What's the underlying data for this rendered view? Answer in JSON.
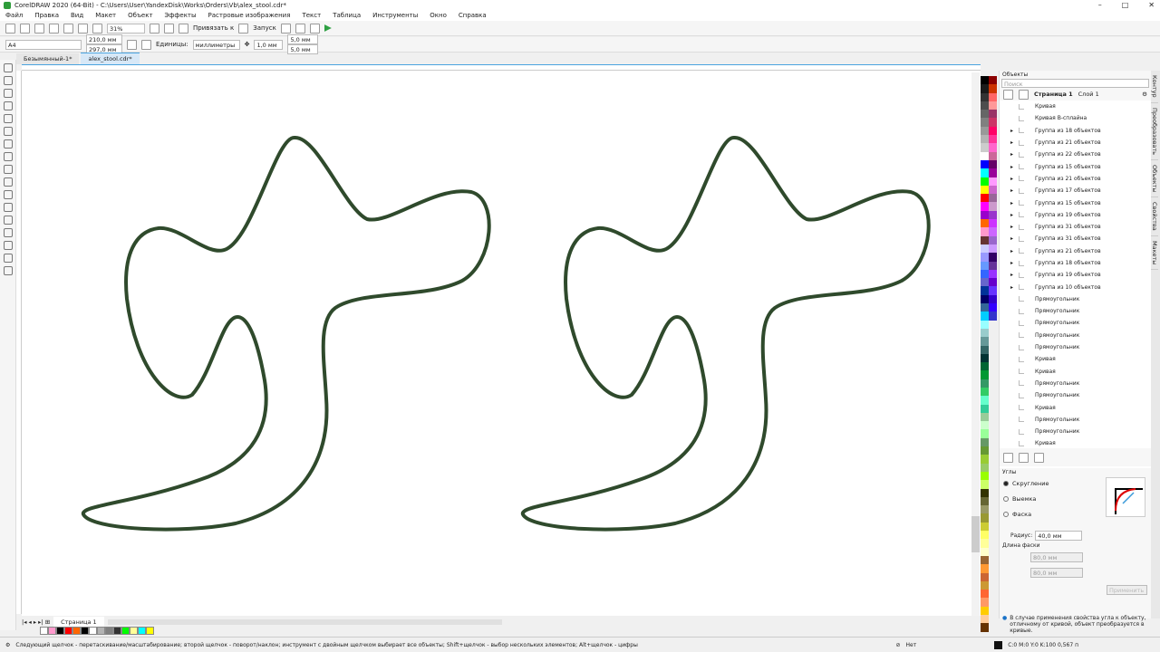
{
  "title": "CorelDRAW 2020 (64-Bit) - C:\\Users\\User\\YandexDisk\\Works\\Orders\\Vb\\alex_stool.cdr*",
  "menu": [
    "Файл",
    "Правка",
    "Вид",
    "Макет",
    "Объект",
    "Эффекты",
    "Растровые изображения",
    "Текст",
    "Таблица",
    "Инструменты",
    "Окно",
    "Справка"
  ],
  "toolbar": {
    "zoom": "31%",
    "snap": "Привязать к",
    "launch": "Запуск"
  },
  "props": {
    "page_size": "A4",
    "width": "210,0 мм",
    "height": "297,0 мм",
    "units_label": "Единицы:",
    "units": "миллиметры",
    "nudge": "1,0 мм",
    "dup_x": "5,0 мм",
    "dup_y": "5,0 мм"
  },
  "tabs": [
    "Безымянный-1*",
    "alex_stool.cdr*"
  ],
  "objects": {
    "search_placeholder": "Поиск",
    "page": "Страница 1",
    "layer": "Слой 1",
    "items": [
      "Кривая",
      "Кривая B-сплайна",
      "Группа из 18 объектов",
      "Группа из 21 объектов",
      "Группа из 22 объектов",
      "Группа из 15 объектов",
      "Группа из 21 объектов",
      "Группа из 17 объектов",
      "Группа из 15 объектов",
      "Группа из 19 объектов",
      "Группа из 31 объектов",
      "Группа из 31 объектов",
      "Группа из 21 объектов",
      "Группа из 18 объектов",
      "Группа из 19 объектов",
      "Группа из 10 объектов",
      "Прямоугольник",
      "Прямоугольник",
      "Прямоугольник",
      "Прямоугольник",
      "Прямоугольник",
      "Кривая",
      "Кривая",
      "Прямоугольник",
      "Прямоугольник",
      "Кривая",
      "Прямоугольник",
      "Прямоугольник",
      "Кривая"
    ],
    "panel_title": "Объекты"
  },
  "corners": {
    "title": "Углы",
    "options": [
      "Скругление",
      "Выемка",
      "Фаска"
    ],
    "radius_label": "Радиус:",
    "radius": "40,0 мм",
    "chamfer_label": "Длина фаски",
    "a": "80,0 мм",
    "b": "80,0 мм",
    "apply": "Применить",
    "info": "В случае применения свойства угла к объекту, отличному от кривой, объект преобразуется в кривые."
  },
  "sidetabs": [
    "Контур",
    "Преобразовать",
    "Объекты",
    "Свойства",
    "Макеты"
  ],
  "page_tab": "Страница 1",
  "status": {
    "hint": "Следующий щелчок - перетаскивание/масштабирование; второй щелчок - поворот/наклон; инструмент с двойным щелчком выбирает все объекты; Shift+щелчок - выбор нескольких элементов; Alt+щелчок - цифры",
    "fill": "Нет",
    "outline": "C:0 M:0 Y:0 K:100  0,567 п"
  },
  "colors": {
    "shape_stroke": "#2f4a2c",
    "accent": "#4aa3df"
  },
  "palette": [
    "#000",
    "#8b0000",
    "#1a1a1a",
    "#cc3300",
    "#333",
    "#ff6666",
    "#4d4d4d",
    "#ff9999",
    "#666",
    "#993366",
    "#808080",
    "#cc3366",
    "#999",
    "#ff0066",
    "#b3b3b3",
    "#ff3399",
    "#ccc",
    "#ff66cc",
    "#fff",
    "#cc6699",
    "#0000ff",
    "#660066",
    "#00ffff",
    "#990099",
    "#00ff00",
    "#ff99ff",
    "#ffff00",
    "#cc66cc",
    "#ff0000",
    "#996699",
    "#ff00ff",
    "#cc99cc",
    "#9900cc",
    "#9933cc",
    "#ff6600",
    "#cc33ff",
    "#ff99cc",
    "#cc66ff",
    "#663333",
    "#9966cc",
    "#ccccff",
    "#cc99ff",
    "#9999ff",
    "#330066",
    "#6699ff",
    "#663399",
    "#3366ff",
    "#9933ff",
    "#6666cc",
    "#6600cc",
    "#003399",
    "#6633ff",
    "#000066",
    "#3300cc",
    "#336699",
    "#3300ff",
    "#00ccff",
    "#3333cc",
    "#99ffff",
    "#f0f0f0",
    "#99cccc",
    "#f0f0f0",
    "#669999",
    "#f0f0f0",
    "#336666",
    "#f0f0f0",
    "#003333",
    "#f0f0f0",
    "#006633",
    "#f0f0f0",
    "#009933",
    "#f0f0f0",
    "#339966",
    "#f0f0f0",
    "#33cc66",
    "#f0f0f0",
    "#66ffcc",
    "#f0f0f0",
    "#33cc99",
    "#f0f0f0",
    "#99cc99",
    "#f0f0f0",
    "#ccffcc",
    "#f0f0f0",
    "#99ff99",
    "#f0f0f0",
    "#669966",
    "#f0f0f0",
    "#669933",
    "#f0f0f0",
    "#99cc33",
    "#f0f0f0",
    "#99cc66",
    "#f0f0f0",
    "#99ff00",
    "#f0f0f0",
    "#ccff66",
    "#f0f0f0",
    "#333300",
    "#f0f0f0",
    "#666633",
    "#f0f0f0",
    "#999966",
    "#f0f0f0",
    "#999933",
    "#f0f0f0",
    "#cccc33",
    "#f0f0f0",
    "#ffff66",
    "#f0f0f0",
    "#ffff99",
    "#f0f0f0",
    "#ffffcc",
    "#f0f0f0",
    "#996633",
    "#f0f0f0",
    "#ff9933",
    "#f0f0f0",
    "#cc6633",
    "#f0f0f0",
    "#cc9933",
    "#f0f0f0",
    "#ff6633",
    "#f0f0f0",
    "#ff9966",
    "#f0f0f0",
    "#ffcc00",
    "#f0f0f0",
    "#ffcc99",
    "#f0f0f0",
    "#663300",
    "#f0f0f0"
  ],
  "doc_palette": [
    "#ffffff",
    "#ff99cc",
    "#000000",
    "#ff0000",
    "#ff6600",
    "#000000",
    "#ffffff",
    "#b3b3b3",
    "#808080",
    "#333333",
    "#00ff00",
    "#ffff99",
    "#00ffff",
    "#ffff00"
  ]
}
